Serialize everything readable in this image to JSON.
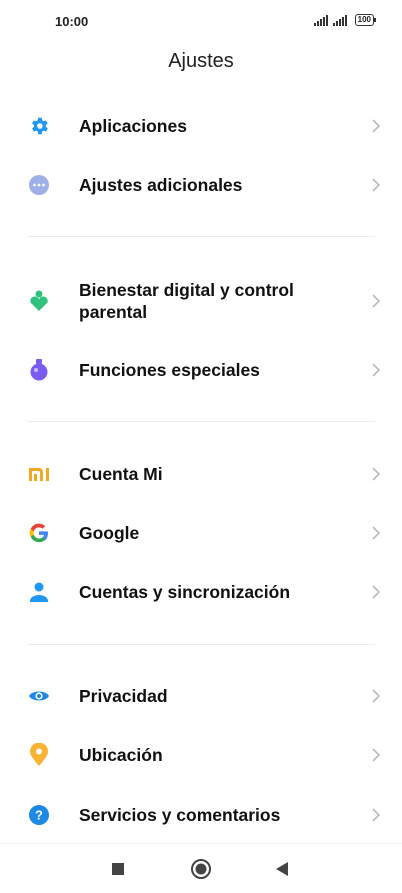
{
  "status_bar": {
    "time": "10:00",
    "battery": "100"
  },
  "header": {
    "title": "Ajustes"
  },
  "groups": [
    [
      {
        "label": "Aplicaciones",
        "icon": "gear-icon"
      },
      {
        "label": "Ajustes adicionales",
        "icon": "more-dots-icon"
      }
    ],
    [
      {
        "label": "Bienestar digital y control parental",
        "icon": "digital-wellbeing-icon"
      },
      {
        "label": "Funciones especiales",
        "icon": "flask-icon"
      }
    ],
    [
      {
        "label": "Cuenta Mi",
        "icon": "mi-logo-icon"
      },
      {
        "label": "Google",
        "icon": "google-g-icon"
      },
      {
        "label": "Cuentas y sincronización",
        "icon": "person-icon"
      }
    ],
    [
      {
        "label": "Privacidad",
        "icon": "eye-icon"
      },
      {
        "label": "Ubicación",
        "icon": "location-pin-icon"
      },
      {
        "label": "Servicios y comentarios",
        "icon": "help-question-icon"
      }
    ]
  ],
  "nav": {
    "recents": "square-icon",
    "home": "circle-home-icon",
    "back": "triangle-back-icon"
  },
  "colors": {
    "accent_blue": "#2196f3",
    "wellbeing_green": "#2ec27e",
    "flask_purple": "#7b5cf0",
    "mi_orange": "#f5a623",
    "location_yellow": "#f9b233"
  }
}
